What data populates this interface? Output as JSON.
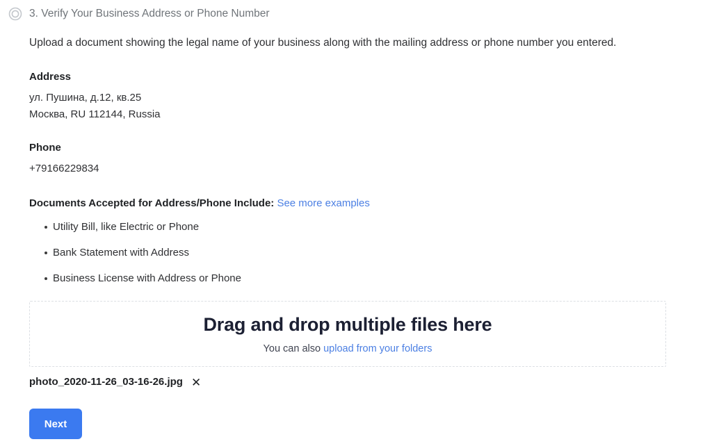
{
  "step": {
    "icon": "circle-outline-icon",
    "title": "3. Verify Your Business Address or Phone Number"
  },
  "intro": "Upload a document showing the legal name of your business along with the mailing address or phone number you entered.",
  "address": {
    "label": "Address",
    "line1": "ул. Пушина, д.12, кв.25",
    "line2": "Москва, RU 112144, Russia"
  },
  "phone": {
    "label": "Phone",
    "value": "+79166229834"
  },
  "documents": {
    "heading": "Documents Accepted for Address/Phone Include:",
    "examples_link": "See more examples",
    "items": [
      "Utility Bill, like Electric or Phone",
      "Bank Statement with Address",
      "Business License with Address or Phone"
    ]
  },
  "dropzone": {
    "title": "Drag and drop multiple files here",
    "sub_prefix": "You can also ",
    "sub_link": "upload from your folders"
  },
  "file": {
    "name": "photo_2020-11-26_03-16-26.jpg",
    "remove_icon": "close-icon",
    "remove_glyph": "✕"
  },
  "actions": {
    "next_label": "Next"
  },
  "colors": {
    "accent_blue": "#3b7af0",
    "link_blue": "#4b7fe3",
    "step_gray": "#70757a",
    "dropzone_border": "#dcdfe4"
  }
}
